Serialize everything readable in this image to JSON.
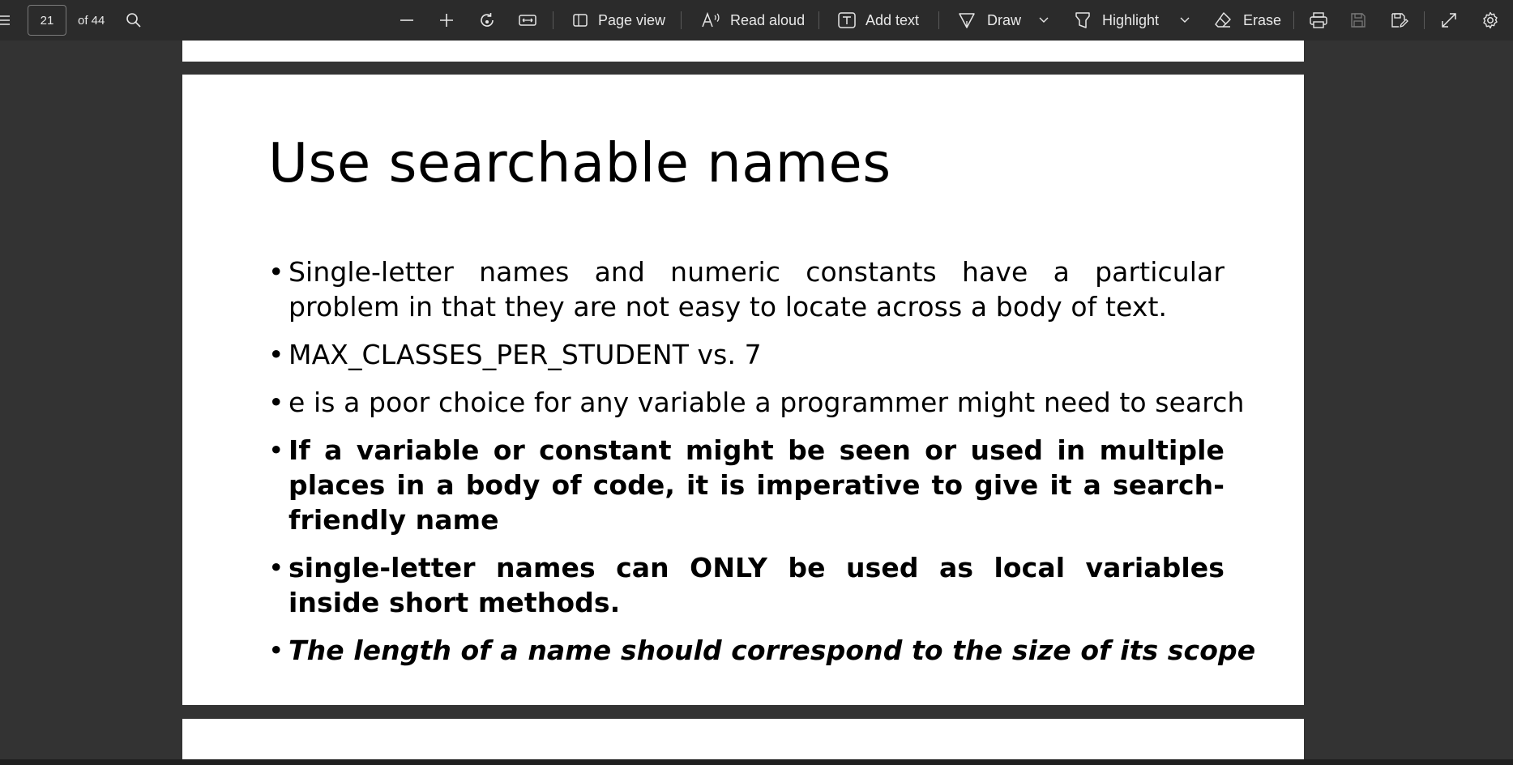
{
  "toolbar": {
    "menu_icon": "hamburger-icon",
    "current_page": "21",
    "page_count_label": "of 44",
    "search_icon": "search-icon",
    "zoom_out_icon": "minus-icon",
    "zoom_in_icon": "plus-icon",
    "rotate_icon": "rotate-icon",
    "fit_icon": "fit-width-icon",
    "page_view_label": "Page view",
    "read_aloud_label": "Read aloud",
    "add_text_label": "Add text",
    "draw_label": "Draw",
    "highlight_label": "Highlight",
    "erase_label": "Erase",
    "print_icon": "printer-icon",
    "save_icon": "save-icon",
    "save_as_icon": "save-as-icon",
    "fullscreen_icon": "expand-icon",
    "settings_icon": "gear-icon"
  },
  "slide": {
    "title": "Use searchable names",
    "bullets": [
      {
        "text": "Single-letter names and numeric constants have a particular problem in that they are not easy to locate across a body of text.",
        "style": "normal"
      },
      {
        "text": "MAX_CLASSES_PER_STUDENT vs. 7",
        "style": "normal"
      },
      {
        "text": "e is a poor choice for any variable a programmer might need to search",
        "style": "normal"
      },
      {
        "text": " If a variable or constant might be seen or used in multiple places in a body of code, it is imperative to give it a search-friendly name",
        "style": "bold"
      },
      {
        "text": "single-letter names can ONLY be used as local variables inside short methods.",
        "style": "bold"
      },
      {
        "text": "The length of a name should correspond to the size of its scope",
        "style": "bold-italic"
      }
    ]
  },
  "colors": {
    "toolbar_bg": "#2b2b2b",
    "viewer_bg": "#333333",
    "page_bg": "#ffffff",
    "toolbar_text": "#e8e8e8"
  }
}
